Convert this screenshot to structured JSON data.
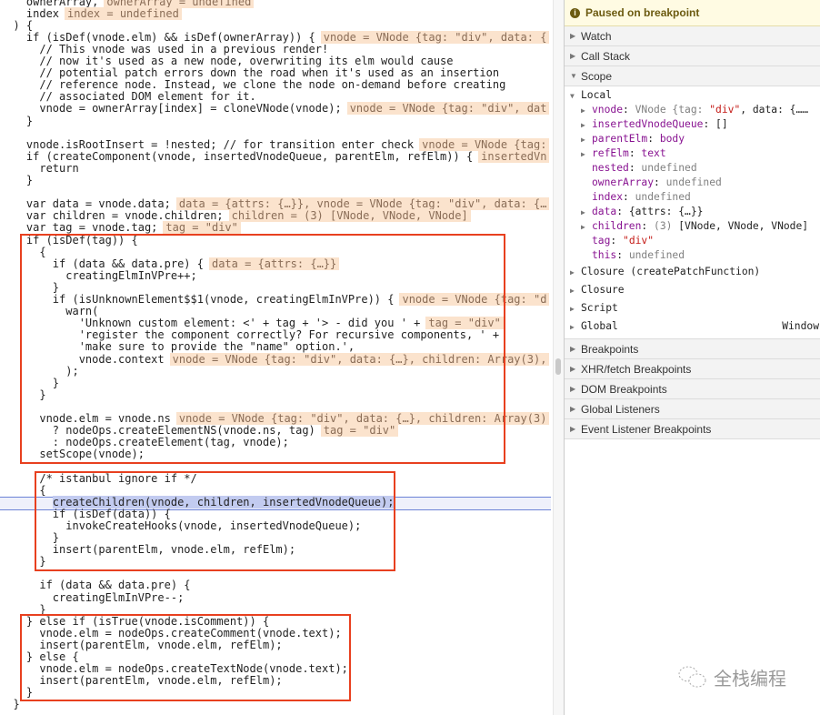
{
  "code": {
    "paused_line": 42,
    "lines": [
      {
        "t": "    ownerArray,",
        "v": "ownerArray = undefined"
      },
      {
        "t": "    index",
        "v": "index = undefined"
      },
      {
        "t": "  ) {"
      },
      {
        "t": "    if (isDef(vnode.elm) && isDef(ownerArray)) {",
        "v": "vnode = VNode {tag: \"div\", data: {"
      },
      {
        "t": "      // This vnode was used in a previous render!"
      },
      {
        "t": "      // now it's used as a new node, overwriting its elm would cause"
      },
      {
        "t": "      // potential patch errors down the road when it's used as an insertion"
      },
      {
        "t": "      // reference node. Instead, we clone the node on-demand before creating"
      },
      {
        "t": "      // associated DOM element for it."
      },
      {
        "t": "      vnode = ownerArray[index] = cloneVNode(vnode);",
        "v": "vnode = VNode {tag: \"div\", dat"
      },
      {
        "t": "    }"
      },
      {
        "t": ""
      },
      {
        "t": "    vnode.isRootInsert = !nested; // for transition enter check",
        "v": "vnode = VNode {tag:"
      },
      {
        "t": "    if (createComponent(vnode, insertedVnodeQueue, parentElm, refElm)) {",
        "v": "insertedVn"
      },
      {
        "t": "      return"
      },
      {
        "t": "    }"
      },
      {
        "t": ""
      },
      {
        "t": "    var data = vnode.data;",
        "v": "data = {attrs: {…}}, vnode = VNode {tag: \"div\", data: {…"
      },
      {
        "t": "    var children = vnode.children;",
        "v": "children = (3) [VNode, VNode, VNode]"
      },
      {
        "t": "    var tag = vnode.tag;",
        "v": "tag = \"div\""
      },
      {
        "t": "    if (isDef(tag)) {"
      },
      {
        "t": "      {"
      },
      {
        "t": "        if (data && data.pre) {",
        "v": "data = {attrs: {…}}"
      },
      {
        "t": "          creatingElmInVPre++;"
      },
      {
        "t": "        }"
      },
      {
        "t": "        if (isUnknownElement$$1(vnode, creatingElmInVPre)) {",
        "v": "vnode = VNode {tag: \"d"
      },
      {
        "t": "          warn("
      },
      {
        "t": "            'Unknown custom element: <' + tag + '> - did you ' +",
        "v": "tag = \"div\""
      },
      {
        "t": "            'register the component correctly? For recursive components, ' +"
      },
      {
        "t": "            'make sure to provide the \"name\" option.',"
      },
      {
        "t": "            vnode.context",
        "v": "vnode = VNode {tag: \"div\", data: {…}, children: Array(3),"
      },
      {
        "t": "          );"
      },
      {
        "t": "        }"
      },
      {
        "t": "      }"
      },
      {
        "t": ""
      },
      {
        "t": "      vnode.elm = vnode.ns",
        "v": "vnode = VNode {tag: \"div\", data: {…}, children: Array(3)"
      },
      {
        "t": "        ? nodeOps.createElementNS(vnode.ns, tag)",
        "v": "tag = \"div\""
      },
      {
        "t": "        : nodeOps.createElement(tag, vnode);"
      },
      {
        "t": "      setScope(vnode);"
      },
      {
        "t": ""
      },
      {
        "t": "      /* istanbul ignore if */"
      },
      {
        "t": "      {"
      },
      {
        "t": "        createChildren(vnode, children, insertedVnodeQueue);"
      },
      {
        "t": "        if (isDef(data)) {"
      },
      {
        "t": "          invokeCreateHooks(vnode, insertedVnodeQueue);"
      },
      {
        "t": "        }"
      },
      {
        "t": "        insert(parentElm, vnode.elm, refElm);"
      },
      {
        "t": "      }"
      },
      {
        "t": ""
      },
      {
        "t": "      if (data && data.pre) {"
      },
      {
        "t": "        creatingElmInVPre--;"
      },
      {
        "t": "      }"
      },
      {
        "t": "    } else if (isTrue(vnode.isComment)) {"
      },
      {
        "t": "      vnode.elm = nodeOps.createComment(vnode.text);"
      },
      {
        "t": "      insert(parentElm, vnode.elm, refElm);"
      },
      {
        "t": "    } else {"
      },
      {
        "t": "      vnode.elm = nodeOps.createTextNode(vnode.text);"
      },
      {
        "t": "      insert(parentElm, vnode.elm, refElm);"
      },
      {
        "t": "    }"
      },
      {
        "t": "  }"
      }
    ]
  },
  "annotation_color": "#e8401f",
  "sidebar": {
    "paused_label": "Paused on breakpoint",
    "info_icon": "i",
    "sections_top": [
      "Watch",
      "Call Stack",
      "Scope"
    ],
    "scope": {
      "local_label": "Local",
      "locals": [
        {
          "k": "vnode",
          "v": "VNode {tag: ",
          "s": "\"div\"",
          "rest": ", data: {……",
          "exp": true
        },
        {
          "k": "insertedVnodeQueue",
          "v": "[]",
          "exp": true,
          "dark": true
        },
        {
          "k": "parentElm",
          "v": "body",
          "exp": true,
          "purple": true
        },
        {
          "k": "refElm",
          "v": "text",
          "exp": true,
          "purple": true
        },
        {
          "k": "nested",
          "v": "undefined"
        },
        {
          "k": "ownerArray",
          "v": "undefined"
        },
        {
          "k": "index",
          "v": "undefined"
        },
        {
          "k": "data",
          "v": "{attrs: {…}}",
          "exp": true,
          "dark": true
        },
        {
          "k": "children",
          "v": "(3) ",
          "rest": "[VNode, VNode, VNode]",
          "exp": true
        },
        {
          "k": "tag",
          "s": "\"div\""
        },
        {
          "k": "this",
          "v": "undefined"
        }
      ],
      "others": [
        "Closure (createPatchFunction)",
        "Closure",
        "Script",
        "Global"
      ],
      "global_value": "Window"
    },
    "sections_bottom": [
      "Breakpoints",
      "XHR/fetch Breakpoints",
      "DOM Breakpoints",
      "Global Listeners",
      "Event Listener Breakpoints"
    ]
  },
  "watermark": {
    "text": "全栈编程",
    "icon": "wechat-icon"
  }
}
